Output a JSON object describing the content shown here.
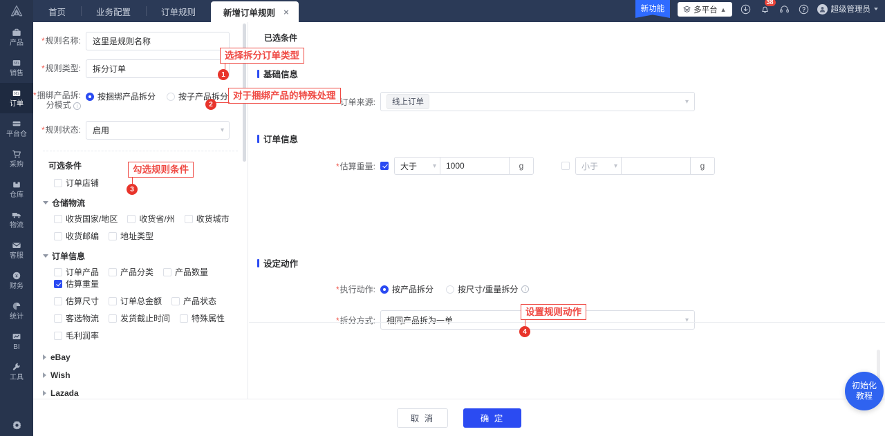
{
  "header": {
    "logo_icon": "app-logo",
    "tabs": [
      {
        "label": "首页",
        "active": false
      },
      {
        "label": "业务配置",
        "active": false
      },
      {
        "label": "订单规则",
        "active": false
      },
      {
        "label": "新增订单规则",
        "active": true,
        "close": "×"
      }
    ],
    "new_feature_label": "新功能",
    "platform_button": "多平台",
    "notification_count": "38",
    "user_name": "超级管理员",
    "icons": [
      "download-icon",
      "bell-icon",
      "headset-icon",
      "help-circle-icon"
    ]
  },
  "rail": {
    "items": [
      {
        "label": "产品",
        "icon": "briefcase-icon",
        "active": false
      },
      {
        "label": "销售",
        "icon": "sale-tag-icon",
        "active": false
      },
      {
        "label": "订单",
        "icon": "order-icon",
        "active": true
      },
      {
        "label": "平台仓",
        "icon": "platform-warehouse-icon",
        "active": false
      },
      {
        "label": "采购",
        "icon": "cart-icon",
        "active": false
      },
      {
        "label": "仓库",
        "icon": "warehouse-icon",
        "active": false
      },
      {
        "label": "物流",
        "icon": "truck-icon",
        "active": false
      },
      {
        "label": "客服",
        "icon": "mail-icon",
        "active": false
      },
      {
        "label": "财务",
        "icon": "coin-icon",
        "active": false
      },
      {
        "label": "统计",
        "icon": "pie-chart-icon",
        "active": false
      },
      {
        "label": "BI",
        "icon": "bi-chart-icon",
        "active": false
      },
      {
        "label": "工具",
        "icon": "wrench-icon",
        "active": false
      }
    ],
    "settings_icon": "gear-icon"
  },
  "left_form": {
    "rule_name": {
      "label": "规则名称:",
      "value": "这里是规则名称"
    },
    "rule_type": {
      "label": "规则类型:",
      "value": "拆分订单"
    },
    "bundle_mode": {
      "label_line1": "捆绑产品拆:",
      "label_line2": "分模式",
      "options": [
        {
          "label": "按捆绑产品拆分",
          "selected": true
        },
        {
          "label": "按子产品拆分",
          "selected": false
        }
      ]
    },
    "rule_status": {
      "label": "规则状态:",
      "value": "启用"
    },
    "optional_conditions_title": "可选条件",
    "standalone_checkbox": {
      "label": "订单店铺",
      "checked": false
    },
    "groups": [
      {
        "title": "仓储物流",
        "expanded": true,
        "rows": [
          [
            {
              "label": "收货国家/地区",
              "checked": false
            },
            {
              "label": "收货省/州",
              "checked": false
            },
            {
              "label": "收货城市",
              "checked": false
            }
          ],
          [
            {
              "label": "收货邮编",
              "checked": false
            },
            {
              "label": "地址类型",
              "checked": false
            }
          ]
        ]
      },
      {
        "title": "订单信息",
        "expanded": true,
        "rows": [
          [
            {
              "label": "订单产品",
              "checked": false
            },
            {
              "label": "产品分类",
              "checked": false
            },
            {
              "label": "产品数量",
              "checked": false
            },
            {
              "label": "估算重量",
              "checked": true
            }
          ],
          [
            {
              "label": "估算尺寸",
              "checked": false
            },
            {
              "label": "订单总金额",
              "checked": false
            },
            {
              "label": "产品状态",
              "checked": false
            }
          ],
          [
            {
              "label": "客选物流",
              "checked": false
            },
            {
              "label": "发货截止时间",
              "checked": false
            },
            {
              "label": "特殊属性",
              "checked": false
            }
          ],
          [
            {
              "label": "毛利润率",
              "checked": false
            }
          ]
        ]
      }
    ],
    "platforms": [
      {
        "label": "eBay",
        "expanded": false
      },
      {
        "label": "Wish",
        "expanded": false
      },
      {
        "label": "Lazada",
        "expanded": false
      }
    ]
  },
  "right_pane": {
    "selected_conditions_title": "已选条件",
    "basic_info": {
      "title": "基础信息",
      "order_source": {
        "label": "订单来源:",
        "tag": "线上订单"
      }
    },
    "order_info": {
      "title": "订单信息",
      "estimated_weight": {
        "label": "估算重量:",
        "first": {
          "checked": true,
          "operator": "大于",
          "value": "1000",
          "unit": "g"
        },
        "second": {
          "checked": false,
          "operator": "小于",
          "value": "",
          "unit": "g"
        }
      }
    },
    "action": {
      "title": "设定动作",
      "execute_label": "执行动作:",
      "execute_options": [
        {
          "label": "按产品拆分",
          "selected": true
        },
        {
          "label": "按尺寸/重量拆分",
          "selected": false,
          "info": true
        }
      ],
      "split_mode": {
        "label": "拆分方式:",
        "value": "相同产品拆为一单"
      }
    }
  },
  "footer": {
    "cancel": "取 消",
    "confirm": "确 定"
  },
  "fab": {
    "line1": "初始化",
    "line2": "教程"
  },
  "annotations": [
    {
      "id": 1,
      "text": "选择拆分订单类型"
    },
    {
      "id": 2,
      "text": "对于捆绑产品的特殊处理"
    },
    {
      "id": 3,
      "text": "勾选规则条件"
    },
    {
      "id": 4,
      "text": "设置规则动作"
    }
  ],
  "colors": {
    "primary": "#2b4bf2",
    "header_bg": "#2b3a57",
    "rail_bg": "#27344d",
    "annotation": "#ef4a44",
    "badge": "#e8443a"
  }
}
